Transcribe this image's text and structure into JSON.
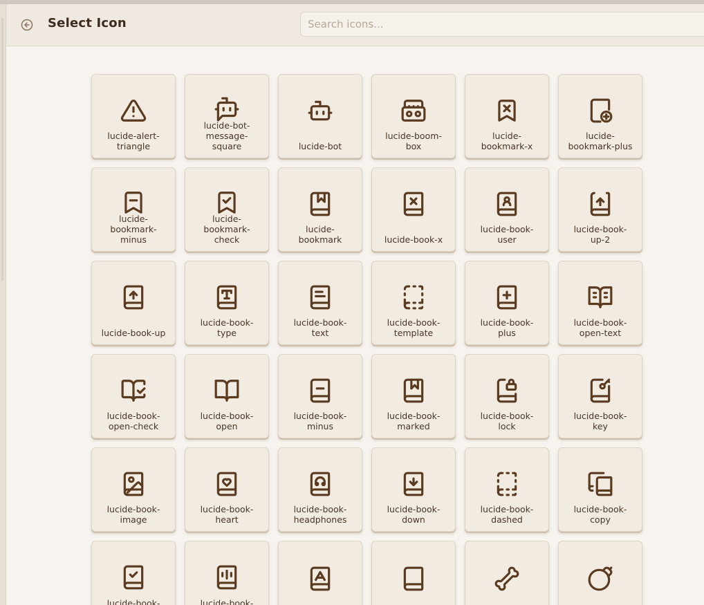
{
  "header": {
    "title": "Select Icon",
    "search_placeholder": "Search icons..."
  },
  "colors": {
    "accent": "#5b3b20",
    "tile_bg": "#f1ebe2",
    "page_bg": "#f7f4ef"
  },
  "icons": [
    {
      "name": "alert-triangle-icon",
      "label_lines": [
        "lucide-alert-",
        "triangle"
      ]
    },
    {
      "name": "bot-message-square-icon",
      "label_lines": [
        "lucide-bot-",
        "message-",
        "square"
      ]
    },
    {
      "name": "bot-icon",
      "label_lines": [
        "lucide-bot"
      ]
    },
    {
      "name": "boom-box-icon",
      "label_lines": [
        "lucide-boom-",
        "box"
      ]
    },
    {
      "name": "bookmark-x-icon",
      "label_lines": [
        "lucide-",
        "bookmark-x"
      ]
    },
    {
      "name": "bookmark-plus-icon",
      "label_lines": [
        "lucide-",
        "bookmark-plus"
      ]
    },
    {
      "name": "bookmark-minus-icon",
      "label_lines": [
        "lucide-",
        "bookmark-",
        "minus"
      ]
    },
    {
      "name": "bookmark-check-icon",
      "label_lines": [
        "lucide-",
        "bookmark-",
        "check"
      ]
    },
    {
      "name": "book-bookmark-icon",
      "label_lines": [
        "lucide-",
        "bookmark"
      ]
    },
    {
      "name": "book-x-icon",
      "label_lines": [
        "lucide-book-x"
      ]
    },
    {
      "name": "book-user-icon",
      "label_lines": [
        "lucide-book-",
        "user"
      ]
    },
    {
      "name": "book-up-2-icon",
      "label_lines": [
        "lucide-book-",
        "up-2"
      ]
    },
    {
      "name": "book-up-icon",
      "label_lines": [
        "lucide-book-up"
      ]
    },
    {
      "name": "book-type-icon",
      "label_lines": [
        "lucide-book-",
        "type"
      ]
    },
    {
      "name": "book-text-icon",
      "label_lines": [
        "lucide-book-",
        "text"
      ]
    },
    {
      "name": "book-template-icon",
      "label_lines": [
        "lucide-book-",
        "template"
      ]
    },
    {
      "name": "book-plus-icon",
      "label_lines": [
        "lucide-book-",
        "plus"
      ]
    },
    {
      "name": "book-open-text-icon",
      "label_lines": [
        "lucide-book-",
        "open-text"
      ]
    },
    {
      "name": "book-open-check-icon",
      "label_lines": [
        "lucide-book-",
        "open-check"
      ]
    },
    {
      "name": "book-open-icon",
      "label_lines": [
        "lucide-book-",
        "open"
      ]
    },
    {
      "name": "book-minus-icon",
      "label_lines": [
        "lucide-book-",
        "minus"
      ]
    },
    {
      "name": "book-marked-icon",
      "label_lines": [
        "lucide-book-",
        "marked"
      ]
    },
    {
      "name": "book-lock-icon",
      "label_lines": [
        "lucide-book-",
        "lock"
      ]
    },
    {
      "name": "book-key-icon",
      "label_lines": [
        "lucide-book-",
        "key"
      ]
    },
    {
      "name": "book-image-icon",
      "label_lines": [
        "lucide-book-",
        "image"
      ]
    },
    {
      "name": "book-heart-icon",
      "label_lines": [
        "lucide-book-",
        "heart"
      ]
    },
    {
      "name": "book-headphones-icon",
      "label_lines": [
        "lucide-book-",
        "headphones"
      ]
    },
    {
      "name": "book-down-icon",
      "label_lines": [
        "lucide-book-",
        "down"
      ]
    },
    {
      "name": "book-dashed-icon",
      "label_lines": [
        "lucide-book-",
        "dashed"
      ]
    },
    {
      "name": "book-copy-icon",
      "label_lines": [
        "lucide-book-",
        "copy"
      ]
    },
    {
      "name": "book-check-icon",
      "label_lines": [
        "lucide-book-"
      ]
    },
    {
      "name": "book-audio-icon",
      "label_lines": [
        "lucide-book-"
      ]
    },
    {
      "name": "book-a-icon",
      "label_lines": []
    },
    {
      "name": "book-icon",
      "label_lines": []
    },
    {
      "name": "bone-icon",
      "label_lines": []
    },
    {
      "name": "bomb-icon",
      "label_lines": []
    }
  ]
}
